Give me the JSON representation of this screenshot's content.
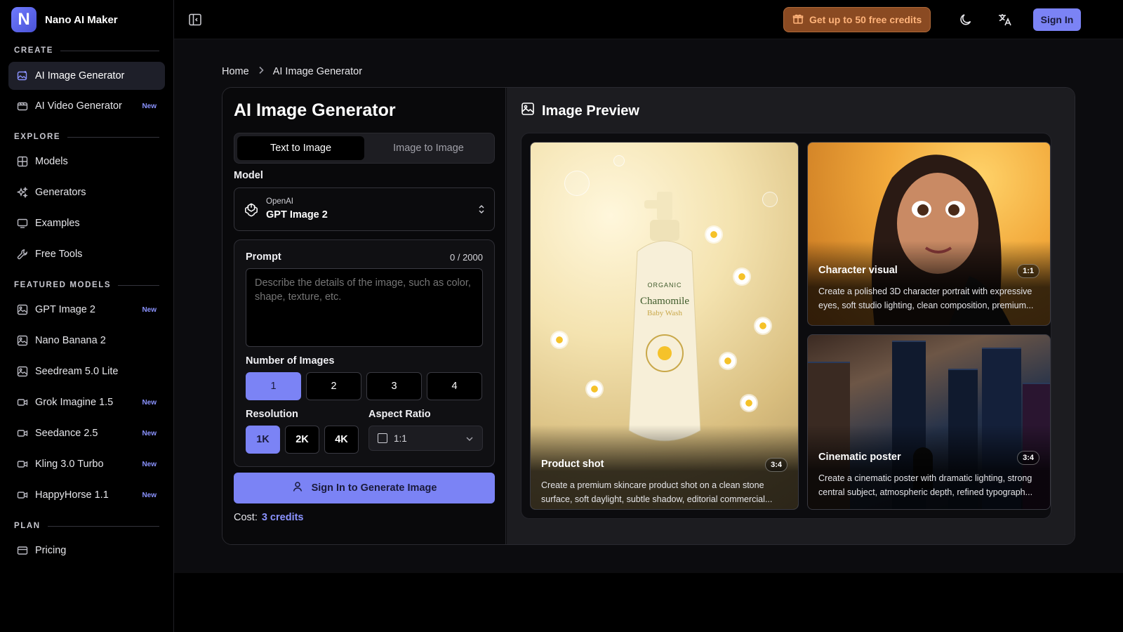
{
  "brand": {
    "logo_letter": "N",
    "name": "Nano AI Maker"
  },
  "sidebar": {
    "sections": {
      "create": "CREATE",
      "explore": "EXPLORE",
      "featured": "FEATURED MODELS",
      "plan": "PLAN"
    },
    "create_items": [
      {
        "label": "AI Image Generator",
        "icon": "image-sparkle-icon",
        "active": true,
        "badge": ""
      },
      {
        "label": "AI Video Generator",
        "icon": "video-icon",
        "active": false,
        "badge": "New"
      }
    ],
    "explore_items": [
      {
        "label": "Models",
        "icon": "grid-icon"
      },
      {
        "label": "Generators",
        "icon": "sparkles-icon"
      },
      {
        "label": "Examples",
        "icon": "monitor-icon"
      },
      {
        "label": "Free Tools",
        "icon": "wrench-icon"
      }
    ],
    "featured_items": [
      {
        "label": "GPT Image 2",
        "icon": "image-icon",
        "badge": "New"
      },
      {
        "label": "Nano Banana 2",
        "icon": "image-icon",
        "badge": ""
      },
      {
        "label": "Seedream 5.0 Lite",
        "icon": "image-icon",
        "badge": ""
      },
      {
        "label": "Grok Imagine 1.5",
        "icon": "video-icon",
        "badge": "New"
      },
      {
        "label": "Seedance 2.5",
        "icon": "video-icon",
        "badge": "New"
      },
      {
        "label": "Kling 3.0 Turbo",
        "icon": "video-icon",
        "badge": "New"
      },
      {
        "label": "HappyHorse 1.1",
        "icon": "video-icon",
        "badge": "New"
      }
    ],
    "plan_items": [
      {
        "label": "Pricing",
        "icon": "credit-card-icon"
      }
    ]
  },
  "topbar": {
    "credits_label": "Get up to 50 free credits",
    "signin_label": "Sign In"
  },
  "breadcrumb": {
    "home": "Home",
    "current": "AI Image Generator"
  },
  "generator": {
    "title": "AI Image Generator",
    "tabs": [
      "Text to Image",
      "Image to Image"
    ],
    "selected_tab": "Text to Image",
    "model_label": "Model",
    "model_provider": "OpenAI",
    "model_name": "GPT Image 2",
    "prompt_label": "Prompt",
    "prompt_count": "0 / 2000",
    "prompt_placeholder": "Describe the details of the image, such as color, shape, texture, etc.",
    "prompt_value": "",
    "num_images_label": "Number of Images",
    "num_images_options": [
      "1",
      "2",
      "3",
      "4"
    ],
    "num_images_selected": "1",
    "resolution_label": "Resolution",
    "resolution_options": [
      "1K",
      "2K",
      "4K"
    ],
    "resolution_selected": "1K",
    "aspect_label": "Aspect Ratio",
    "aspect_value": "1:1",
    "generate_label": "Sign In to Generate Image",
    "cost_label": "Cost:",
    "cost_value": "3 credits"
  },
  "preview": {
    "title": "Image Preview",
    "cards": [
      {
        "title": "Product shot",
        "ratio": "3:4",
        "desc": "Create a premium skincare product shot on a clean stone surface, soft daylight, subtle shadow, editorial commercial..."
      },
      {
        "title": "Character visual",
        "ratio": "1:1",
        "desc": "Create a polished 3D character portrait with expressive eyes, soft studio lighting, clean composition, premium..."
      },
      {
        "title": "Cinematic poster",
        "ratio": "3:4",
        "desc": "Create a cinematic poster with dramatic lighting, strong central subject, atmospheric depth, refined typograph..."
      }
    ],
    "bottle_text": {
      "top": "ORGANIC",
      "brand": "Chamomile",
      "sub": "Baby Wash"
    }
  },
  "colors": {
    "accent": "#7b83f5",
    "credits_bg": "#8a4a22",
    "credits_text": "#ffb37a",
    "badge_new": "#8b93ff"
  }
}
